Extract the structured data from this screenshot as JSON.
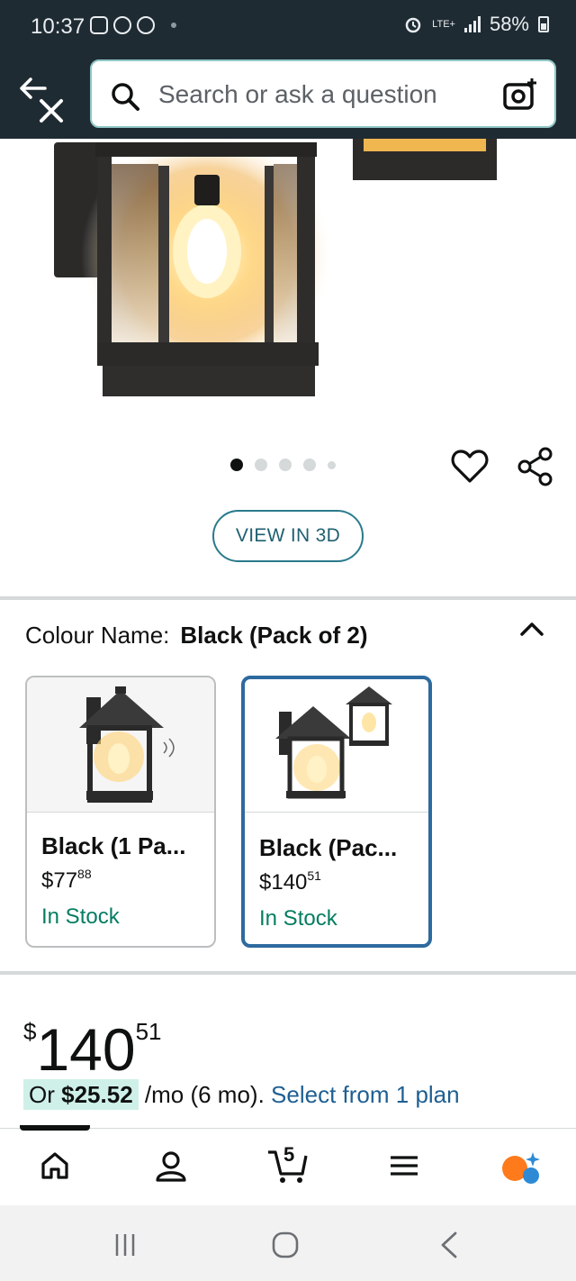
{
  "status_bar": {
    "time": "10:37",
    "network": "LTE+",
    "battery": "58%"
  },
  "search": {
    "placeholder": "Search or ask a question"
  },
  "gallery": {
    "image_count": 5,
    "active_index": 0,
    "view_3d_label": "VIEW IN 3D"
  },
  "colour": {
    "label": "Colour Name:",
    "selected": "Black (Pack of 2)",
    "options": [
      {
        "name": "Black (1 Pa...",
        "price_whole": "$77",
        "price_cents": "88",
        "stock": "In Stock",
        "selected": false
      },
      {
        "name": "Black (Pac...",
        "price_whole": "$140",
        "price_cents": "51",
        "stock": "In Stock",
        "selected": true
      }
    ]
  },
  "price": {
    "currency": "$",
    "whole": "140",
    "cents": "51"
  },
  "financing": {
    "prefix": "Or",
    "amount": "$25.52",
    "term": "/mo (6 mo).",
    "link": "Select from 1 plan"
  },
  "bottom_nav": {
    "cart_count": "5"
  },
  "colors": {
    "header_bg": "#1f2b33",
    "accent_teal": "#2a7a8c",
    "selected_border": "#2d6a9f",
    "in_stock_green": "#067d62",
    "link_blue": "#1f5f92"
  }
}
